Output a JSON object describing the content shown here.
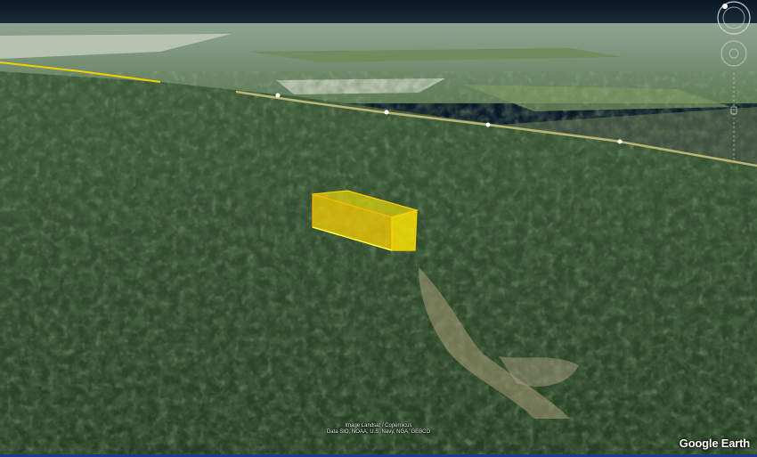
{
  "attribution": {
    "line1": "Image Landsat / Copernicus",
    "line2": "Data SIO, NOAA, U.S. Navy, NGA, GEBCO"
  },
  "brand": "Google Earth",
  "colors": {
    "box_fill": "#ffee00",
    "box_edge": "#ffcc00",
    "forest": "#2e4a2a",
    "road": "#f0d000"
  },
  "icons": [
    "compass-icon",
    "look-joystick-icon",
    "zoom-slider-icon"
  ]
}
